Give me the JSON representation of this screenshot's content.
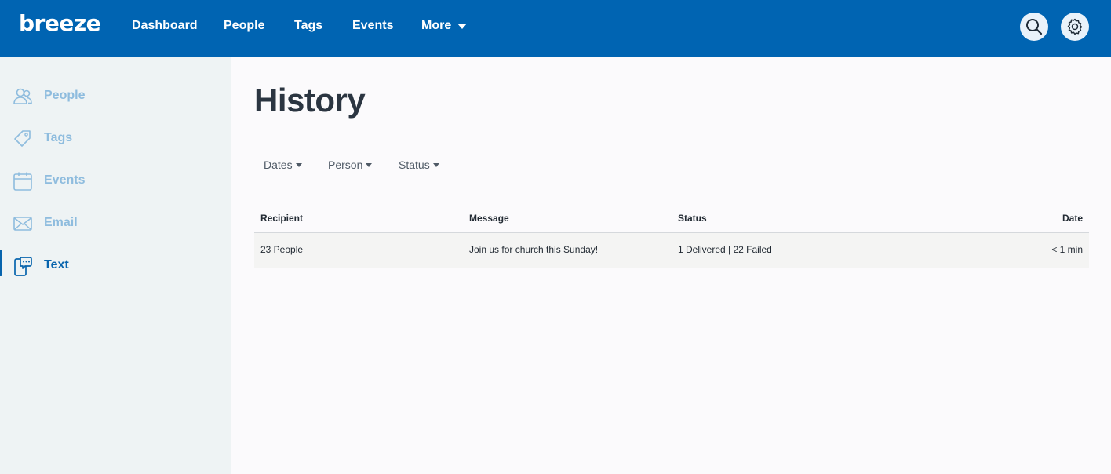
{
  "app": {
    "logo_text": "breeze"
  },
  "topnav": {
    "items": [
      "Dashboard",
      "People",
      "Tags",
      "Events"
    ],
    "more_label": "More"
  },
  "sidebar": {
    "items": [
      {
        "label": "People",
        "icon": "people-icon"
      },
      {
        "label": "Tags",
        "icon": "tag-icon"
      },
      {
        "label": "Events",
        "icon": "calendar-icon"
      },
      {
        "label": "Email",
        "icon": "envelope-icon"
      },
      {
        "label": "Text",
        "icon": "text-message-icon",
        "active": true
      }
    ]
  },
  "main": {
    "title": "History",
    "filters": [
      "Dates",
      "Person",
      "Status"
    ],
    "table": {
      "columns": [
        "Recipient",
        "Message",
        "Status",
        "Date"
      ],
      "rows": [
        {
          "recipient": "23 People",
          "message": "Join us for church this Sunday!",
          "status": "1 Delivered | 22 Failed",
          "date": "< 1 min"
        }
      ]
    }
  },
  "colors": {
    "topbar": "#0064b2",
    "sidebar_bg": "#eef3f4",
    "sidebar_inactive": "#8ebcde",
    "sidebar_active": "#0764ad",
    "title": "#2b3541"
  }
}
